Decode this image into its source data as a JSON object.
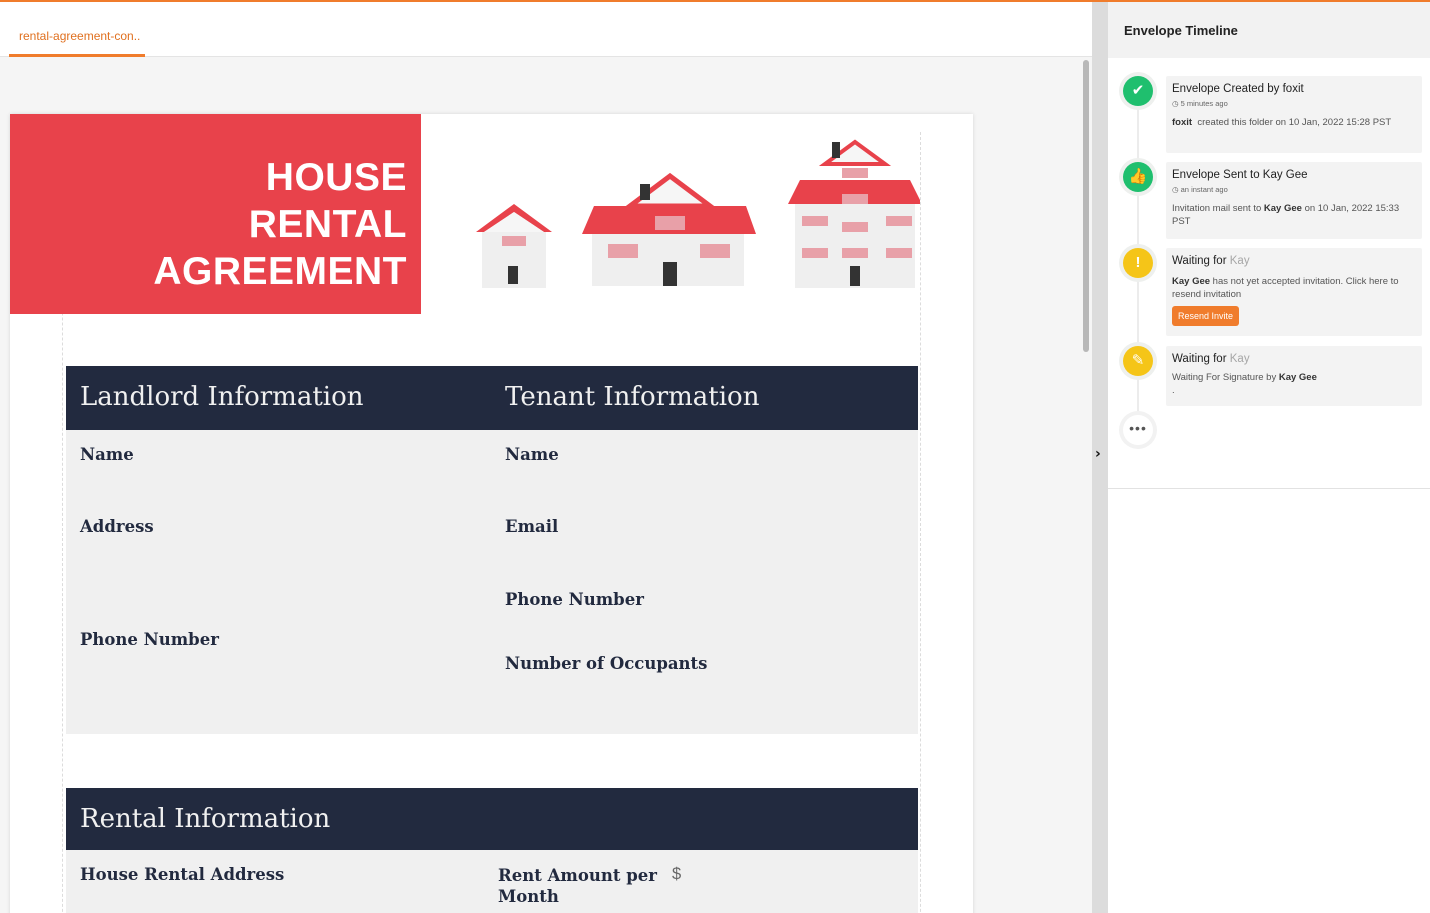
{
  "tab": {
    "label": "rental-agreement-con.."
  },
  "document": {
    "banner_title_lines": [
      "HOUSE",
      "RENTAL",
      "AGREEMENT"
    ],
    "sections": {
      "parties": {
        "left_title": "Landlord Information",
        "right_title": "Tenant Information"
      },
      "landlord_fields": [
        "Name",
        "Address",
        "Phone Number"
      ],
      "tenant_fields": [
        "Name",
        "Email",
        "Phone Number",
        "Number of Occupants"
      ],
      "rental": {
        "title": "Rental Information"
      },
      "rental_fields": {
        "address": "House Rental Address",
        "rent_amount": "Rent Amount per Month",
        "currency": "$"
      }
    },
    "colors": {
      "banner": "#e8424b",
      "section_header": "#222a3f",
      "accent": "#f07c2c"
    }
  },
  "timeline": {
    "title": "Envelope Timeline",
    "events": [
      {
        "icon": "check-icon",
        "title_prefix": "Envelope Created by foxit",
        "title_muted": "",
        "time": "5 minutes ago",
        "desc_bold": "foxit",
        "desc": "created this folder on 10 Jan, 2022 15:28 PST",
        "color": "#1fbf6e"
      },
      {
        "icon": "thumbs-up-icon",
        "title_prefix": "Envelope Sent to Kay Gee",
        "title_muted": "",
        "time": "an instant ago",
        "desc_pre": "Invitation mail sent to",
        "desc_bold": "Kay Gee",
        "desc": "on 10 Jan, 2022 15:33 PST",
        "color": "#1fbf6e"
      },
      {
        "icon": "exclamation-icon",
        "title_prefix": "Waiting for",
        "title_muted": "Kay",
        "desc_bold": "Kay Gee",
        "desc": "has not yet accepted invitation. Click here to resend invitation",
        "button": "Resend Invite",
        "color": "#f5c518"
      },
      {
        "icon": "sign-edit-icon",
        "title_prefix": "Waiting for",
        "title_muted": "Kay",
        "desc_pre": "Waiting For Signature by",
        "desc_bold": "Kay Gee",
        "desc_tail": ".",
        "color": "#f5c518"
      }
    ],
    "more_label": "•••"
  },
  "collapse_label": "›"
}
